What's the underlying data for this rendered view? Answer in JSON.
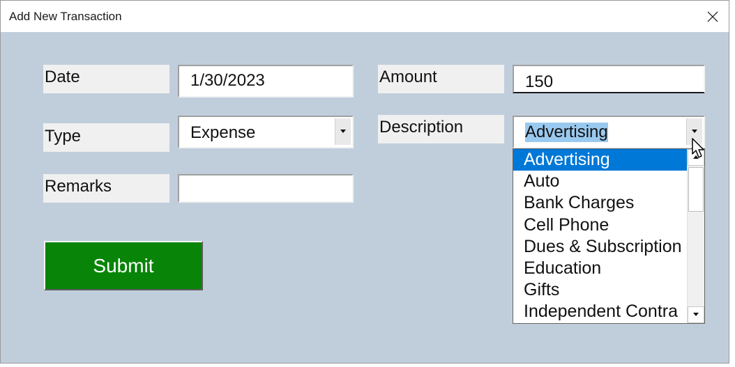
{
  "window": {
    "title": "Add New Transaction"
  },
  "icons": {
    "close": "close-icon",
    "dropdown_arrow": "chevron-down-icon",
    "scroll_up": "triangle-up-icon",
    "scroll_down": "triangle-down-icon",
    "cursor": "mouse-pointer-icon"
  },
  "colors": {
    "dialog_background": "#c0cedc",
    "submit_button": "#088408",
    "list_selection": "#0078d7",
    "text_selection": "#99c9ef"
  },
  "form": {
    "date": {
      "label": "Date",
      "value": "1/30/2023"
    },
    "type": {
      "label": "Type",
      "value": "Expense"
    },
    "remarks": {
      "label": "Remarks",
      "value": ""
    },
    "amount": {
      "label": "Amount",
      "value": "150"
    },
    "description": {
      "label": "Description",
      "value": "Advertising"
    },
    "submit_label": "Submit"
  },
  "description_dropdown": {
    "selected": "Advertising",
    "options": [
      "Advertising",
      "Auto",
      "Bank Charges",
      "Cell Phone",
      "Dues & Subscription",
      "Education",
      "Gifts",
      "Independent Contra"
    ]
  }
}
